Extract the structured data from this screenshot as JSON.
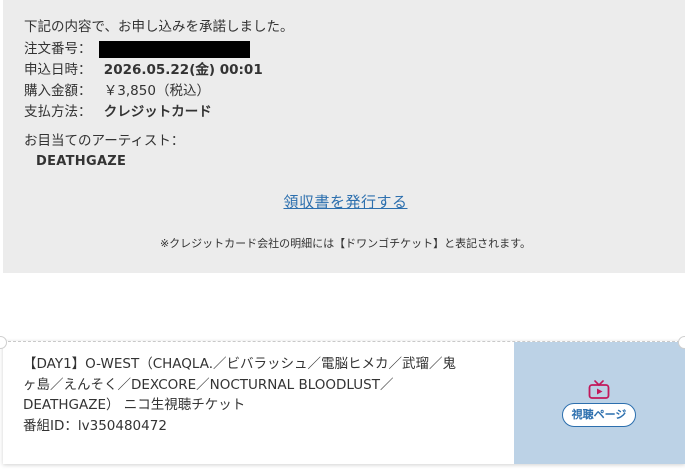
{
  "confirmation": {
    "intro": "下記の内容で、お申し込みを承諾しました。",
    "order_number_label": "注文番号：",
    "date_label": "申込日時：",
    "date_value": "2026.05.22(金) 00:01",
    "amount_label": "購入金額：",
    "amount_value": "￥3,850（税込）",
    "payment_label": "支払方法：",
    "payment_value": "クレジットカード",
    "artist_label": "お目当てのアーティスト：",
    "artist_value": "DEATHGAZE",
    "receipt_link": "領収書を発行する",
    "note": "※クレジットカード会社の明細には【ドワンゴチケット】と表記されます。"
  },
  "ticket": {
    "title_lines": [
      "【DAY1】O-WEST（CHAQLA.／ビバラッシュ／電脳ヒメカ／武瑠／鬼",
      "ヶ島／えんそく／DEXCORE／NOCTURNAL BLOODLUST／",
      "DEATHGAZE） ニコ生視聴チケット"
    ],
    "program_id": "番組ID：lv350480472",
    "watch_button": "視聴ページ",
    "watch_icon": "tv-play-icon"
  },
  "colors": {
    "link": "#2c6fae",
    "panel_bg": "#ececec",
    "watch_panel_bg": "#bcd2e6",
    "icon": "#c2185b"
  }
}
